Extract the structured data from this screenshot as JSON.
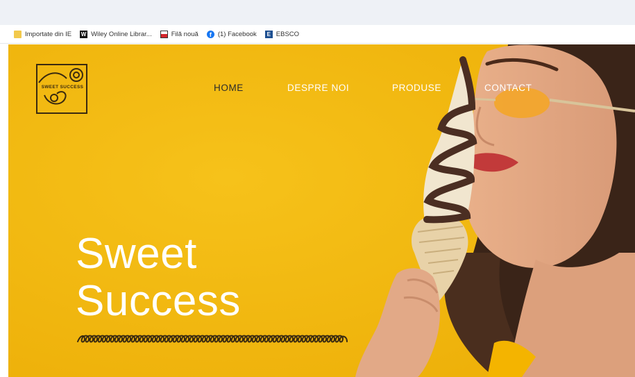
{
  "browser": {
    "bookmarks": [
      {
        "label": "Importate din IE",
        "icon": "folder-icon"
      },
      {
        "label": "Wiley Online Librar...",
        "icon": "wiley-icon"
      },
      {
        "label": "Filă nouă",
        "icon": "new-tab-icon"
      },
      {
        "label": "(1) Facebook",
        "icon": "facebook-icon"
      },
      {
        "label": "EBSCO",
        "icon": "ebsco-icon"
      }
    ]
  },
  "site": {
    "logo_text": "SWEET SUCCESS",
    "nav": {
      "home": "HOME",
      "despre": "DESPRE NOI",
      "produse": "PRODUSE",
      "contact": "CONTACT"
    },
    "hero": {
      "title_line1": "Sweet",
      "title_line2": "Success"
    },
    "colors": {
      "background": "#f2b90e",
      "text": "#ffffff",
      "logo": "#3a2a10"
    }
  }
}
